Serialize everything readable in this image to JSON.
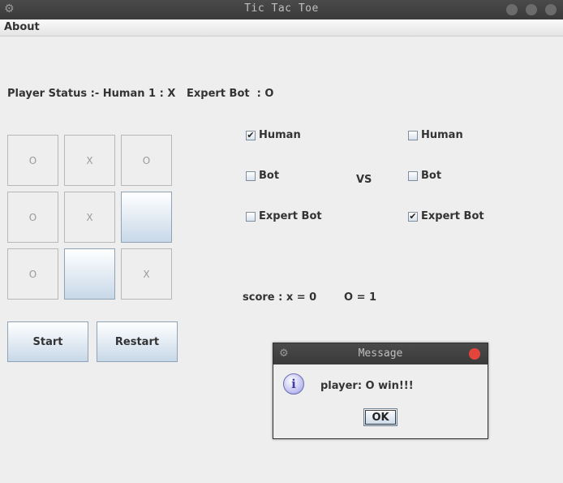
{
  "window": {
    "title": "Tic Tac Toe"
  },
  "menu": {
    "about": "About"
  },
  "status": {
    "player1": "Player Status :- Human 1 : X",
    "player2": "Expert Bot  : O"
  },
  "board": {
    "cells": [
      "O",
      "X",
      "O",
      "O",
      "X",
      "",
      "O",
      "",
      "X"
    ]
  },
  "buttons": {
    "start": "Start",
    "restart": "Restart"
  },
  "left_options": [
    {
      "label": "Human",
      "checked": true
    },
    {
      "label": "Bot",
      "checked": false
    },
    {
      "label": "Expert Bot",
      "checked": false
    }
  ],
  "right_options": [
    {
      "label": "Human",
      "checked": false
    },
    {
      "label": "Bot",
      "checked": false
    },
    {
      "label": "Expert Bot",
      "checked": true
    }
  ],
  "vs": "VS",
  "score": {
    "x": "score : x = 0",
    "o": "O = 1"
  },
  "dialog": {
    "title": "Message",
    "message": "player: O win!!!",
    "ok": "OK"
  },
  "colors": {
    "titlebar": "#3d3d3d",
    "close": "#e2453c",
    "button_gradient_end": "#c8d8e8"
  }
}
